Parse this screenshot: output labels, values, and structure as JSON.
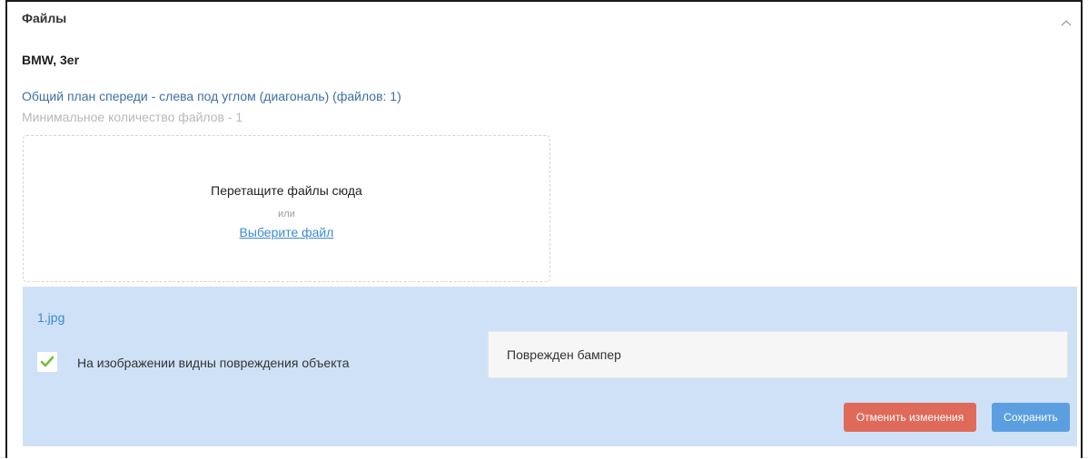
{
  "header": {
    "title": "Файлы",
    "collapse_icon": "chevron-up-icon"
  },
  "subject": "BMW, 3er",
  "category": {
    "title": "Общий план спереди - слева под углом (диагональ) (файлов: 1)",
    "min_files": "Минимальное количество файлов - 1"
  },
  "dropzone": {
    "text": "Перетащите файлы сюда",
    "or": "или",
    "link": "Выберите файл"
  },
  "file": {
    "name": "1.jpg",
    "damage_checkbox_label": "На изображении видны повреждения объекта",
    "damage_checked": true,
    "comment_value": "Поврежден бампер",
    "cancel_label": "Отменить изменения",
    "save_label": "Сохранить"
  },
  "colors": {
    "accent_blue": "#3c8ad6",
    "card_bg": "#cfe1f6",
    "cancel_red": "#e06a5a",
    "save_blue": "#5b9fe0",
    "check_green": "#6fbf3a"
  }
}
